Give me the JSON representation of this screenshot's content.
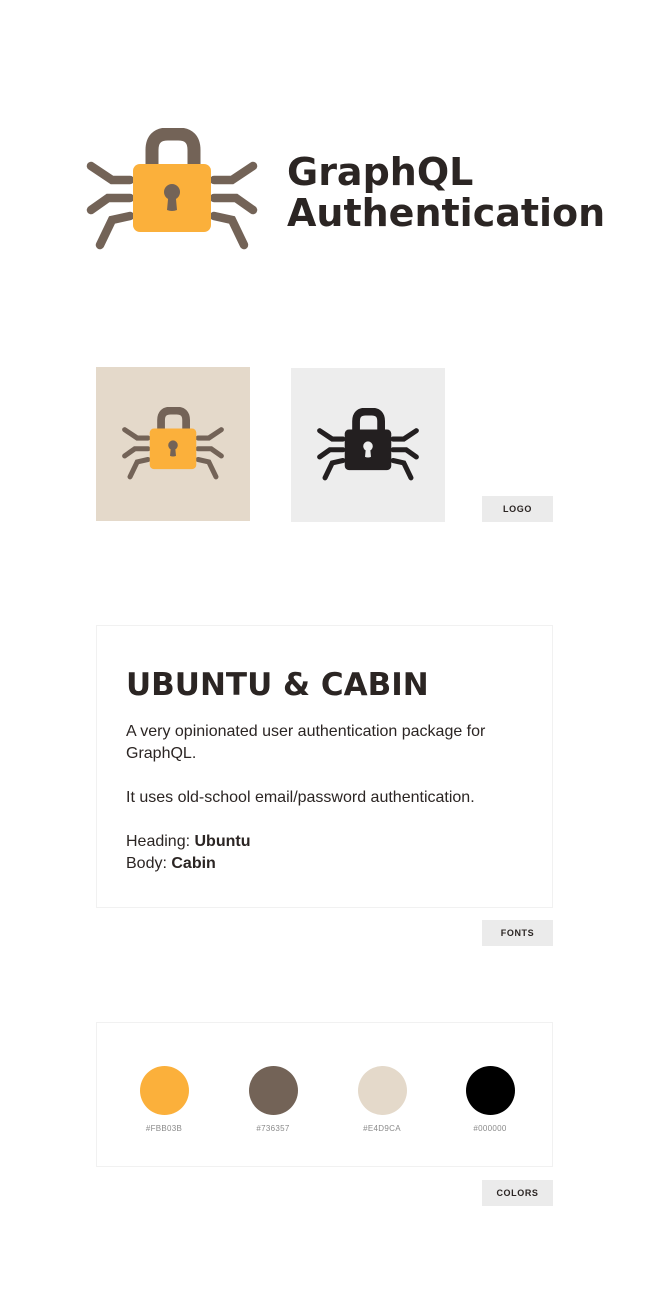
{
  "header": {
    "title_line1": "GraphQL",
    "title_line2": "Authentication"
  },
  "logo_section": {
    "tag": "LOGO"
  },
  "fonts_section": {
    "heading": "UBUNTU & CABIN",
    "description": "A very opinionated user authentication package for GraphQL.",
    "note": "It uses old-school email/password authentication.",
    "heading_label": "Heading:",
    "heading_font": "Ubuntu",
    "body_label": "Body:",
    "body_font": "Cabin",
    "tag": "FONTS"
  },
  "colors_section": {
    "swatches": [
      {
        "hex": "#FBB03B",
        "color": "#FBB03B"
      },
      {
        "hex": "#736357",
        "color": "#736357"
      },
      {
        "hex": "#E4D9CA",
        "color": "#E4D9CA"
      },
      {
        "hex": "#000000",
        "color": "#000000"
      }
    ],
    "tag": "COLORS"
  },
  "icons": [
    "padlock-bug-icon",
    "padlock-bug-icon-mono"
  ],
  "palette": {
    "accent": "#FBB03B",
    "brown": "#736357",
    "beige": "#E4D9CA",
    "dark": "#2B2523",
    "tile_light": "#EDEDED"
  }
}
